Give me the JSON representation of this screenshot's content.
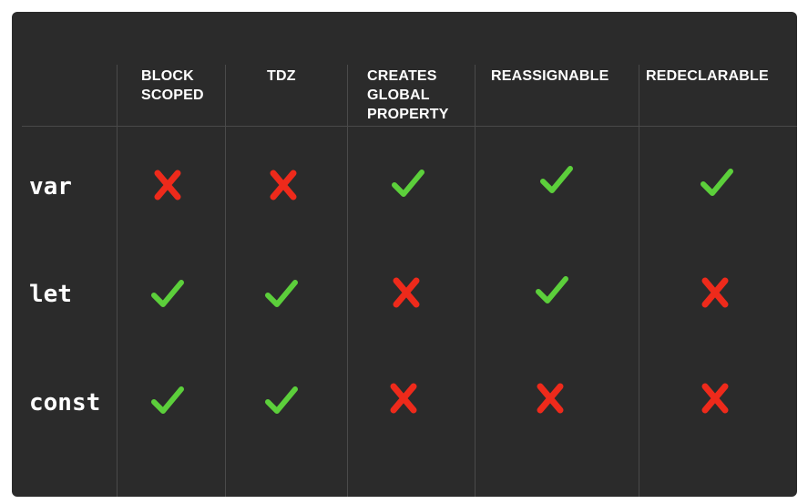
{
  "colors": {
    "background": "#2b2b2b",
    "divider": "#4a4a4a",
    "text": "#ffffff",
    "check": "#5ccf3b",
    "cross": "#ee2a1b"
  },
  "columns": [
    {
      "id": "block-scoped",
      "label": "BLOCK\nSCOPED"
    },
    {
      "id": "tdz",
      "label": "TDZ"
    },
    {
      "id": "creates-global-property",
      "label": "CREATES\nGLOBAL\nPROPERTY"
    },
    {
      "id": "reassignable",
      "label": "REASSIGNABLE"
    },
    {
      "id": "redeclarable",
      "label": "REDECLARABLE"
    }
  ],
  "rows": [
    {
      "keyword": "var",
      "values": [
        "cross-icon",
        "cross-icon",
        "check-icon",
        "check-icon",
        "check-icon"
      ]
    },
    {
      "keyword": "let",
      "values": [
        "check-icon",
        "check-icon",
        "cross-icon",
        "check-icon",
        "cross-icon"
      ]
    },
    {
      "keyword": "const",
      "values": [
        "check-icon",
        "check-icon",
        "cross-icon",
        "cross-icon",
        "cross-icon"
      ]
    }
  ]
}
